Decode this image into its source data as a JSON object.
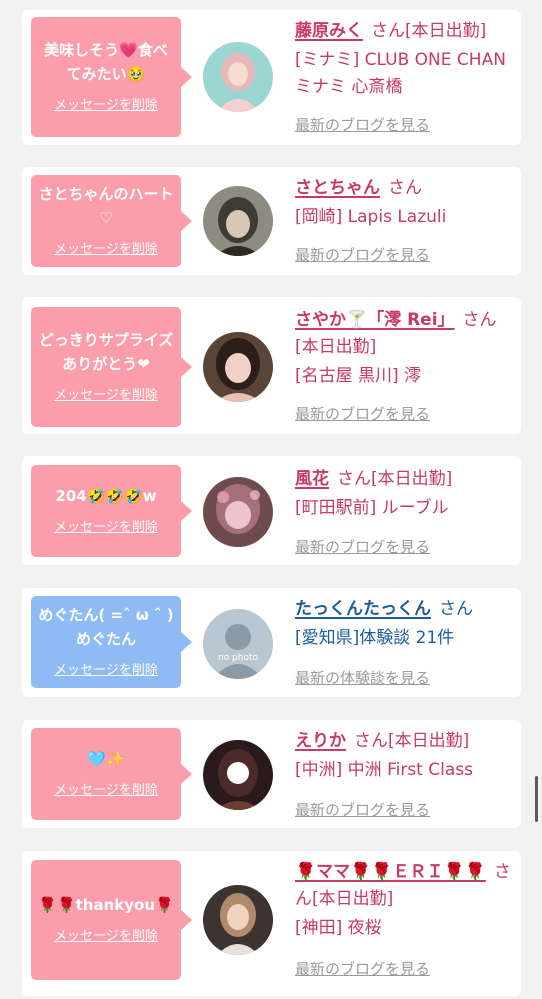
{
  "cards": [
    {
      "message": "美味しそう💗食べてみたい🥹",
      "delete_label": "メッセージを削除",
      "name": "藤原みく",
      "honorific": "さん",
      "status": "[本日出勤]",
      "area": "[ミナミ]",
      "shop": "CLUB ONE CHAN ミナミ 心斎橋",
      "link": "最新のブログを見る"
    },
    {
      "message": "さとちゃんのハート♡",
      "delete_label": "メッセージを削除",
      "name": "さとちゃん",
      "honorific": "さん",
      "status": "",
      "area": "[岡崎]",
      "shop": "Lapis Lazuli",
      "link": "最新のブログを見る"
    },
    {
      "message": "どっきりサプライズありがとう❤︎",
      "delete_label": "メッセージを削除",
      "name": "さやか🍸「澪 Rei」",
      "honorific": "さん",
      "status": "[本日出勤]",
      "area": "[名古屋 黒川]",
      "shop": "澪",
      "link": "最新のブログを見る"
    },
    {
      "message": "204🤣🤣🤣w",
      "delete_label": "メッセージを削除",
      "name": "風花",
      "honorific": "さん",
      "status": "[本日出勤]",
      "area": "[町田駅前]",
      "shop": "ルーブル",
      "link": "最新のブログを見る"
    },
    {
      "message": "めぐたん( =ˆ ω ˆ )めぐたん",
      "delete_label": "メッセージを削除",
      "name": "たっくんたっくん",
      "honorific": "さん",
      "status": "",
      "area": "[愛知県]",
      "shop": "体験談 21件",
      "link": "最新の体験談を見る",
      "avatar_text": "no photo"
    },
    {
      "message": "🩵✨",
      "delete_label": "メッセージを削除",
      "name": "えりか",
      "honorific": "さん",
      "status": "[本日出勤]",
      "area": "[中洲]",
      "shop": "中洲 First Class",
      "link": "最新のブログを見る"
    },
    {
      "message": "🌹🌹thankyou🌹",
      "delete_label": "メッセージを削除",
      "name": "🌹ママ🌹🌹ＥＲＩ🌹🌹",
      "honorific": "さん",
      "status": "[本日出勤]",
      "area": "[神田]",
      "shop": "夜桜",
      "link": "最新のブログを見る"
    }
  ]
}
